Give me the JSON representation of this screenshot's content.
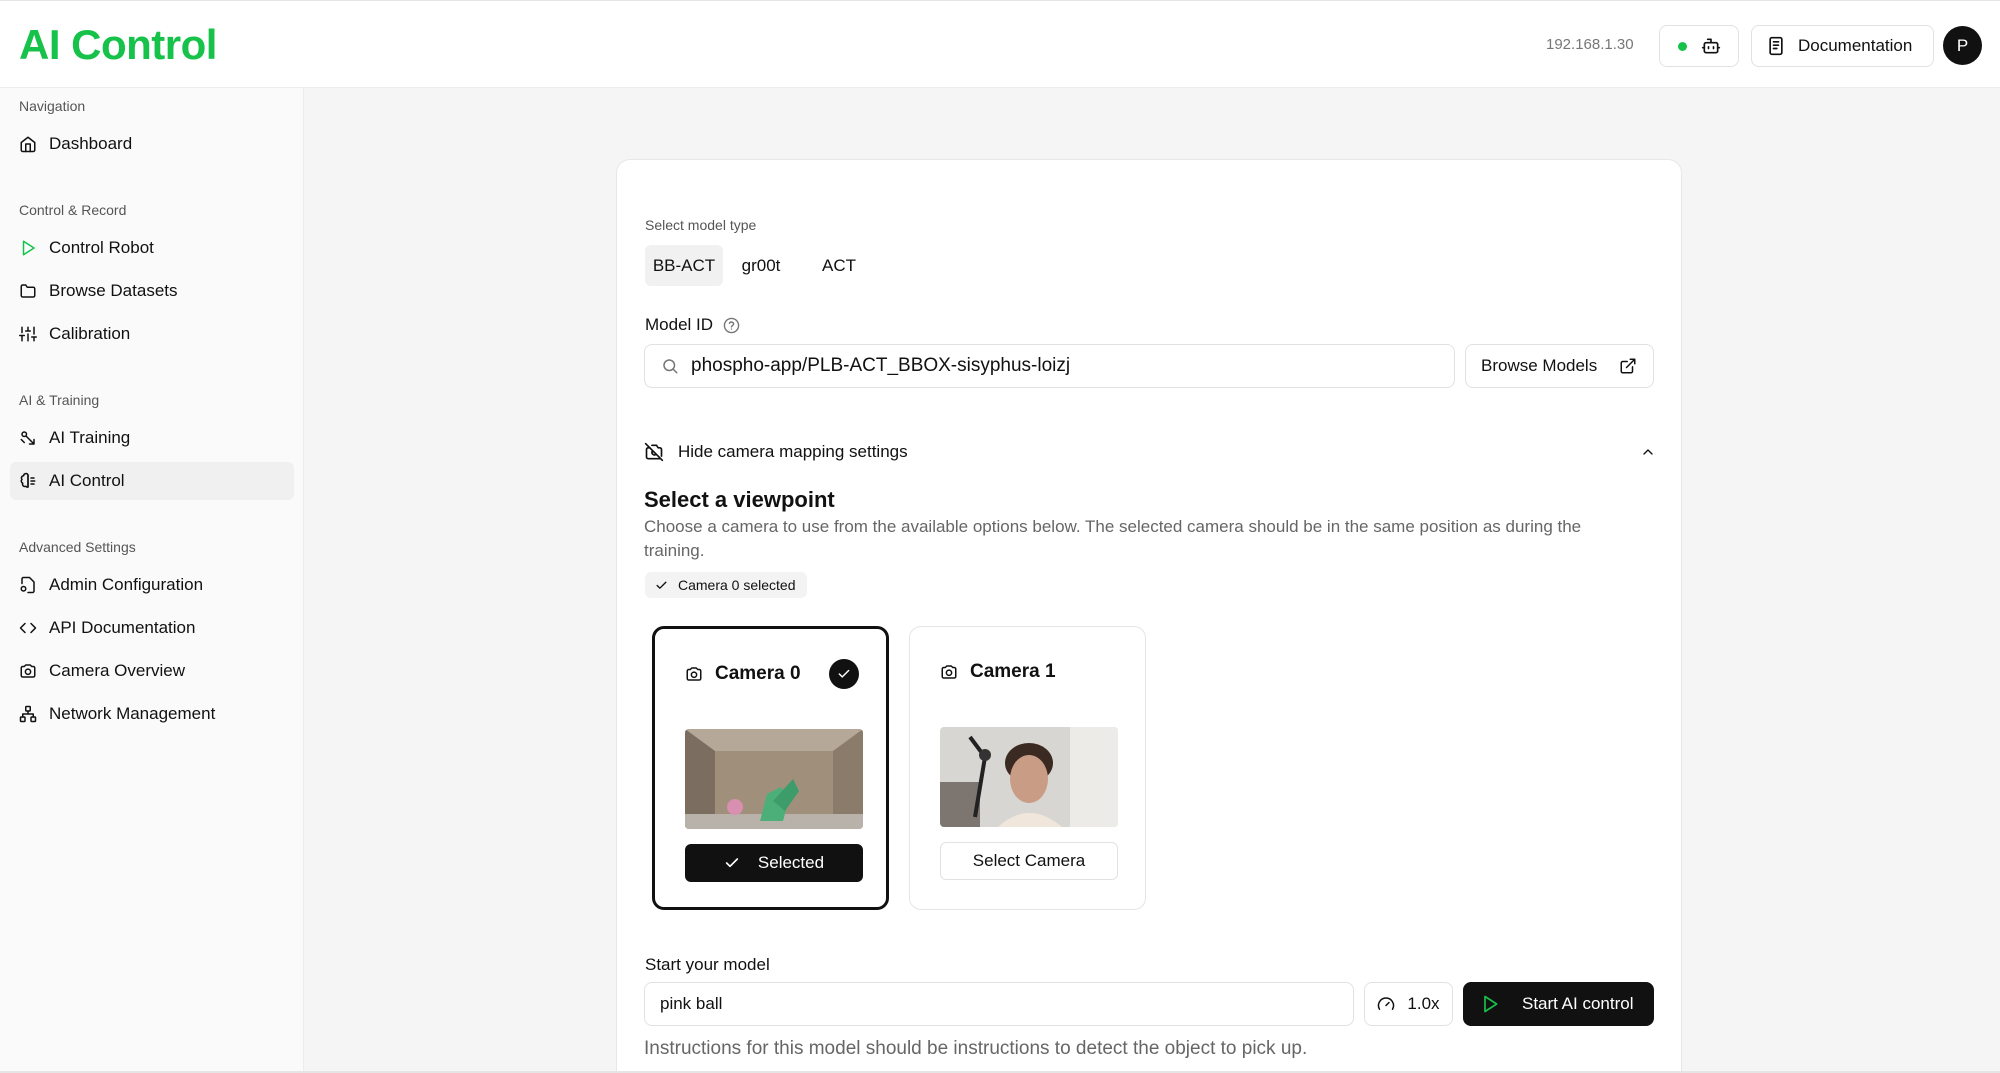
{
  "header": {
    "app_title": "AI Control",
    "ip_address": "192.168.1.30",
    "status_color": "#16c24a",
    "documentation_label": "Documentation",
    "avatar_initial": "P"
  },
  "sidebar": {
    "sections": {
      "navigation": "Navigation",
      "control_record": "Control & Record",
      "ai_training": "AI & Training",
      "advanced": "Advanced Settings"
    },
    "items": {
      "dashboard": "Dashboard",
      "control_robot": "Control Robot",
      "browse_datasets": "Browse Datasets",
      "calibration": "Calibration",
      "ai_training": "AI Training",
      "ai_control": "AI Control",
      "admin_configuration": "Admin Configuration",
      "api_documentation": "API Documentation",
      "camera_overview": "Camera Overview",
      "network_management": "Network Management"
    }
  },
  "main": {
    "model_type_label": "Select model type",
    "model_types": [
      "BB-ACT",
      "gr00t",
      "ACT"
    ],
    "selected_model_type": "BB-ACT",
    "model_id_label": "Model ID",
    "model_id_value": "phospho-app/PLB-ACT_BBOX-sisyphus-loizj",
    "browse_models_label": "Browse Models",
    "camera_toggle_label": "Hide camera mapping settings",
    "viewpoint_title": "Select a viewpoint",
    "viewpoint_description": "Choose a camera to use from the available options below. The selected camera should be in the same position as during the training.",
    "selected_badge": "Camera 0 selected",
    "cameras": [
      {
        "title": "Camera 0",
        "button_label": "Selected",
        "selected": true
      },
      {
        "title": "Camera 1",
        "button_label": "Select Camera",
        "selected": false
      }
    ],
    "start_label": "Start your model",
    "instruction_value": "pink ball",
    "speed_label": "1.0x",
    "start_button_label": "Start AI control",
    "hint_text": "Instructions for this model should be instructions to detect the object to pick up."
  }
}
